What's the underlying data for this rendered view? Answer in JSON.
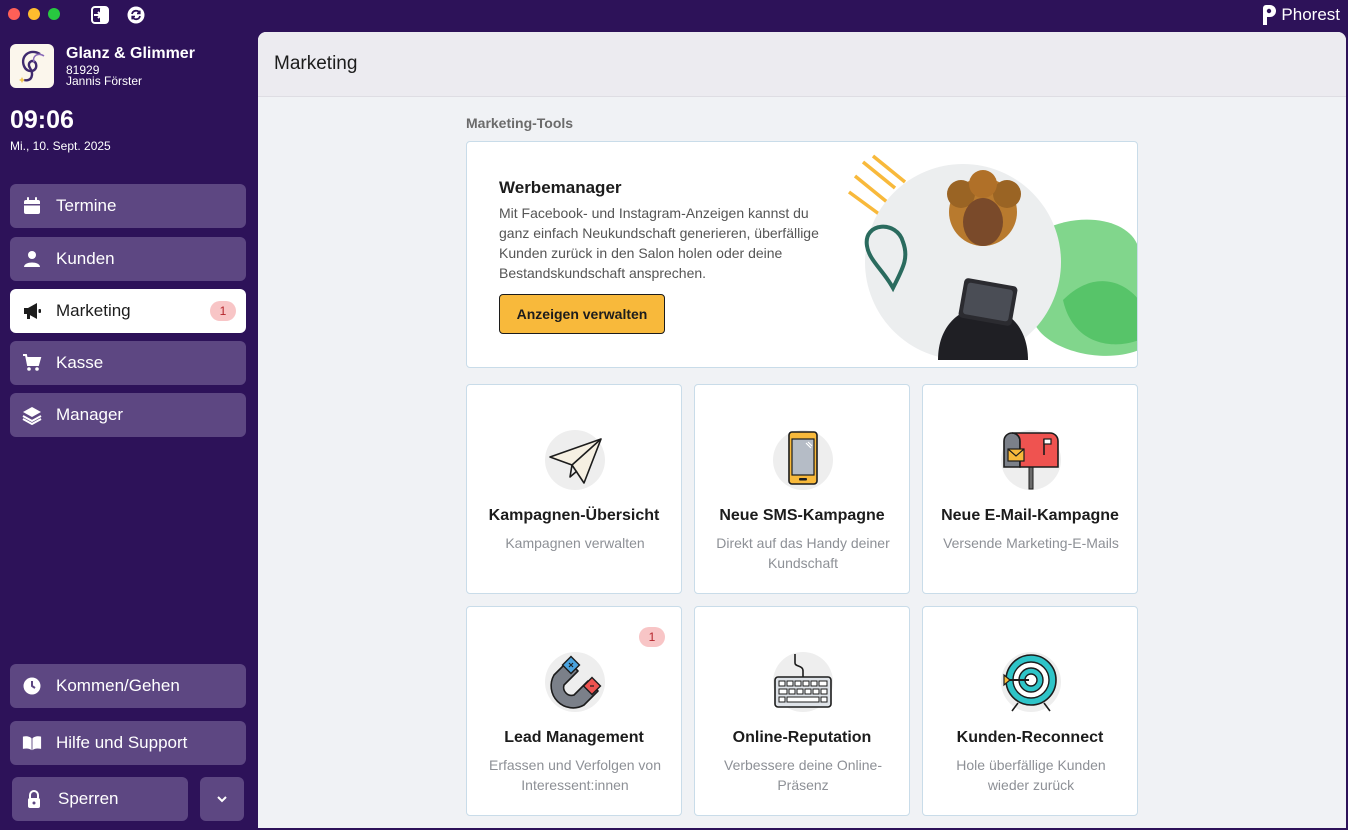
{
  "app": {
    "brand_name": "Phorest"
  },
  "salon": {
    "name": "Glanz & Glimmer",
    "id": "81929",
    "user": "Jannis Förster"
  },
  "clock": {
    "time": "09:06",
    "date": "Mi., 10. Sept. 2025"
  },
  "sidebar": {
    "items": [
      {
        "label": "Termine",
        "icon": "calendar-icon"
      },
      {
        "label": "Kunden",
        "icon": "person-icon"
      },
      {
        "label": "Marketing",
        "icon": "megaphone-icon",
        "badge": "1",
        "active": true
      },
      {
        "label": "Kasse",
        "icon": "cart-icon"
      },
      {
        "label": "Manager",
        "icon": "layers-icon"
      }
    ],
    "bottom": {
      "clock_in_label": "Kommen/Gehen",
      "help_label": "Hilfe und Support",
      "lock_label": "Sperren"
    }
  },
  "main": {
    "header_title": "Marketing",
    "section_title": "Marketing-Tools",
    "hero": {
      "title": "Werbemanager",
      "text": "Mit Facebook- und Instagram-Anzeigen kannst du ganz einfach Neukundschaft generieren, überfällige Kunden zurück in den Salon holen oder deine Bestandskundschaft ansprechen.",
      "button_label": "Anzeigen verwalten"
    },
    "cards": [
      {
        "title": "Kampagnen-Übersicht",
        "desc": "Kampagnen verwalten",
        "icon": "paper-plane-icon"
      },
      {
        "title": "Neue SMS-Kampagne",
        "desc": "Direkt auf das Handy deiner Kundschaft",
        "icon": "phone-icon"
      },
      {
        "title": "Neue E-Mail-Kampagne",
        "desc": "Versende Marketing-E-Mails",
        "icon": "mailbox-icon"
      },
      {
        "title": "Lead Management",
        "desc": "Erfassen und Verfolgen von Interessent:innen",
        "icon": "magnet-icon",
        "badge": "1"
      },
      {
        "title": "Online-Reputation",
        "desc": "Verbessere deine Online-Präsenz",
        "icon": "keyboard-icon"
      },
      {
        "title": "Kunden-Reconnect",
        "desc": "Hole überfällige Kunden wieder zurück",
        "icon": "target-icon"
      }
    ]
  },
  "colors": {
    "sidebar_bg": "#2d1259",
    "nav_item_bg": "#5d4782",
    "accent_button": "#f8b93b",
    "badge_bg": "#f8c5c6",
    "badge_text": "#b4232a"
  }
}
